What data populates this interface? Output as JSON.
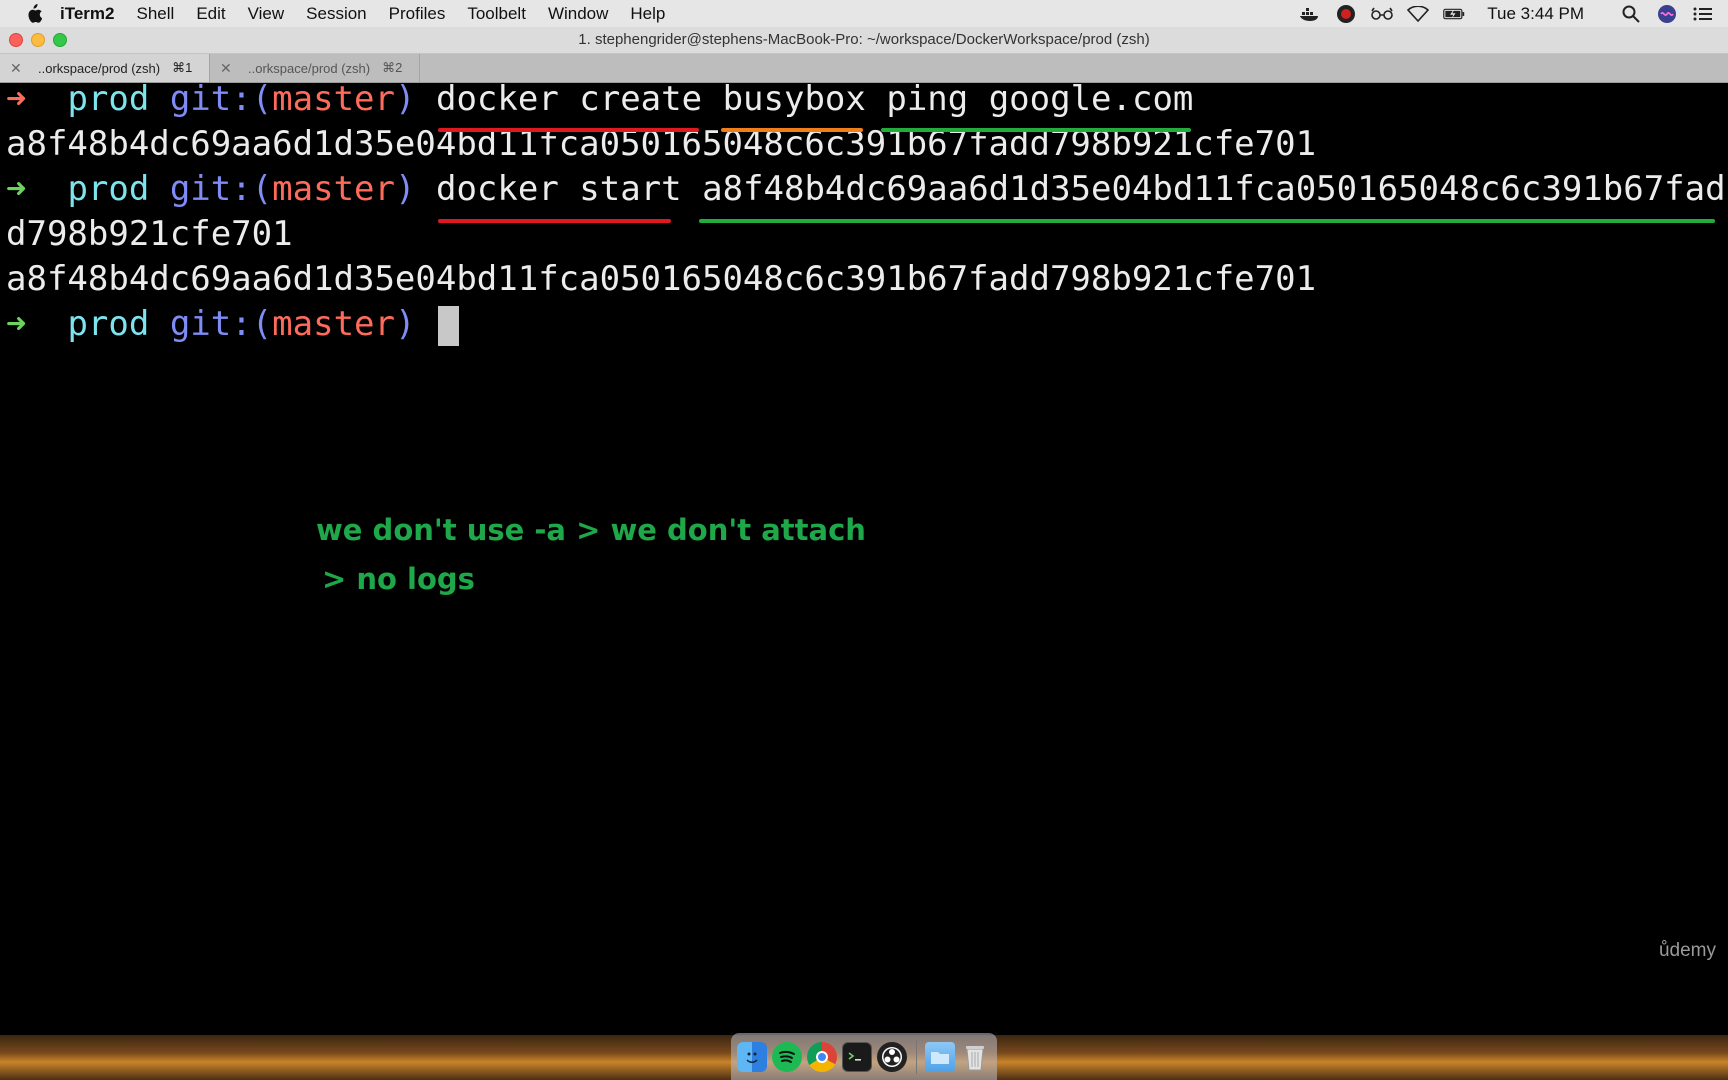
{
  "menubar": {
    "app": "iTerm2",
    "menus": [
      "Shell",
      "Edit",
      "View",
      "Session",
      "Profiles",
      "Toolbelt",
      "Window",
      "Help"
    ],
    "clock": "Tue 3:44 PM",
    "icons": [
      "apple-icon",
      "docker-icon",
      "screen-recorder-icon",
      "glasses-icon",
      "wifi-icon",
      "battery-icon",
      "spotlight-search-icon",
      "siri-icon",
      "notification-center-icon"
    ]
  },
  "window": {
    "title": "1. stephengrider@stephens-MacBook-Pro: ~/workspace/DockerWorkspace/prod (zsh)"
  },
  "tabs": [
    {
      "label": "..orkspace/prod (zsh)",
      "shortcut": "⌘1",
      "active": true
    },
    {
      "label": "..orkspace/prod (zsh)",
      "shortcut": "⌘2",
      "active": false
    }
  ],
  "terminal": {
    "prompt_arrow": "➜",
    "prompt_dir": "prod",
    "prompt_git": "git:(",
    "prompt_branch": "master",
    "prompt_close": ")",
    "cmd1_a": "docker create",
    "cmd1_b": "busybox",
    "cmd1_c": "ping google.com",
    "out1": "a8f48b4dc69aa6d1d35e04bd11fca050165048c6c391b67fadd798b921cfe701",
    "cmd2_a": "docker start",
    "cmd2_b": "a8f48b4dc69aa6d1d35e04bd11fca050165048c6c391b67fad",
    "cmd2_wrap": "d798b921cfe701",
    "out2": "a8f48b4dc69aa6d1d35e04bd11fca050165048c6c391b67fadd798b921cfe701"
  },
  "annotation": {
    "line1": "we don't use -a > we don't attach",
    "line2": "> no logs"
  },
  "watermark": "ůdemy",
  "dock": {
    "icons": [
      "finder-icon",
      "spotify-icon",
      "chrome-icon",
      "terminal-icon",
      "obs-icon",
      "folder-icon",
      "trash-icon"
    ]
  },
  "colors": {
    "underline_red": "#e0181f",
    "underline_orange": "#f07f17",
    "underline_green": "#1fae3b",
    "annotation_green": "#1fa84a"
  }
}
